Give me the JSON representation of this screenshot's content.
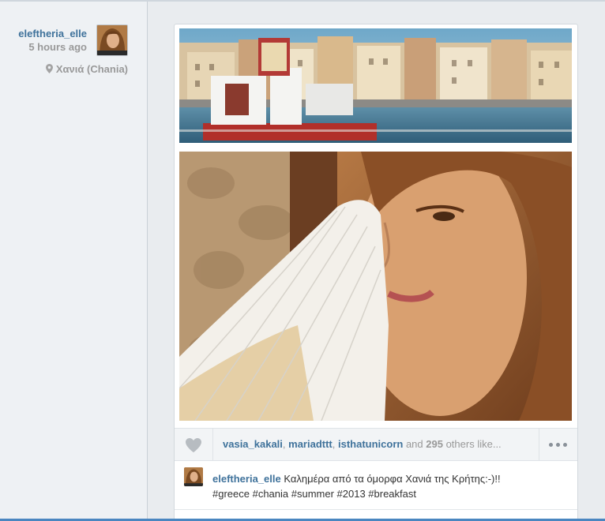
{
  "post": {
    "username": "eleftheria_elle",
    "timestamp": "5 hours ago",
    "location": "Χανιά (Chania)"
  },
  "likes": {
    "likers": [
      "vasia_kakali",
      "mariadttt",
      "isthatunicorn"
    ],
    "separator": ", ",
    "and_text": " and ",
    "others_count": "295",
    "others_text": " others like..."
  },
  "caption": {
    "username": "eleftheria_elle",
    "text": "Καλημέρα από τα όμορφα Χανιά της Κρήτης:-)!!",
    "hashtags": "#greece #chania #summer #2013 #breakfast"
  },
  "icons": {
    "location": "map-pin-icon",
    "like": "heart-icon",
    "more": "more-dots-icon"
  },
  "colors": {
    "username": "#3f729b",
    "meta_gray": "#999999",
    "bottom_accent": "#4a86c0"
  }
}
